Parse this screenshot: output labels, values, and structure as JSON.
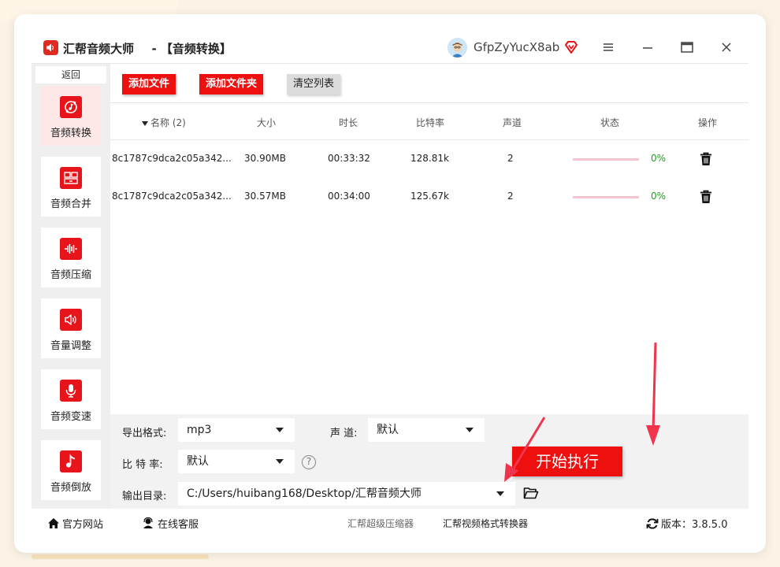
{
  "window": {
    "title": "汇帮音频大师",
    "subtitle": "- 【音频转换】",
    "username": "GfpZyYucX8ab"
  },
  "sidebar": {
    "back_label": "返回",
    "items": [
      {
        "label": "音频转换",
        "icon": "audio-convert-icon",
        "active": true
      },
      {
        "label": "音频合并",
        "icon": "audio-merge-icon",
        "active": false
      },
      {
        "label": "音频压缩",
        "icon": "audio-compress-icon",
        "active": false
      },
      {
        "label": "音量调整",
        "icon": "volume-icon",
        "active": false
      },
      {
        "label": "音频变速",
        "icon": "microphone-icon",
        "active": false
      },
      {
        "label": "音频倒放",
        "icon": "music-note-icon",
        "active": false
      }
    ]
  },
  "toolbar": {
    "add_file": "添加文件",
    "add_folder": "添加文件夹",
    "clear_list": "清空列表"
  },
  "table": {
    "headers": {
      "name": "名称 (2)",
      "size": "大小",
      "duration": "时长",
      "bitrate": "比特率",
      "channels": "声道",
      "status": "状态",
      "action": "操作"
    },
    "rows": [
      {
        "name": "8c1787c9dca2c05a342...",
        "size": "30.90MB",
        "duration": "00:33:32",
        "bitrate": "128.81k",
        "channels": "2",
        "progress": 0,
        "percent": "0%"
      },
      {
        "name": "8c1787c9dca2c05a342...",
        "size": "30.57MB",
        "duration": "00:34:00",
        "bitrate": "125.67k",
        "channels": "2",
        "progress": 0,
        "percent": "0%"
      }
    ]
  },
  "settings": {
    "format_label": "导出格式:",
    "format_value": "mp3",
    "channel_label": "声 道:",
    "channel_value": "默认",
    "bitrate_label": "比 特 率:",
    "bitrate_value": "默认",
    "help": "?",
    "output_label": "输出目录:",
    "output_value": "C:/Users/huibang168/Desktop/汇帮音频大师"
  },
  "start_button": "开始执行",
  "footer": {
    "website": "官方网站",
    "support": "在线客服",
    "link1": "汇帮超级压缩器",
    "link2": "汇帮视频格式转换器",
    "version": "版本：3.8.5.0"
  },
  "colors": {
    "accent": "#ee0f0f",
    "success": "#1aa31a",
    "annotation_arrow": "#f0344e"
  }
}
